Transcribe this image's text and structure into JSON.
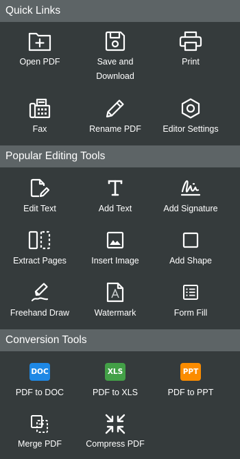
{
  "quick_links": {
    "title": "Quick Links",
    "items": [
      {
        "label": "Open PDF",
        "icon": "folder-plus-icon"
      },
      {
        "label": "Save and\nDownload",
        "icon": "floppy-disk-icon"
      },
      {
        "label": "Print",
        "icon": "printer-icon"
      },
      {
        "label": "Fax",
        "icon": "fax-machine-icon"
      },
      {
        "label": "Rename PDF",
        "icon": "pencil-icon"
      },
      {
        "label": "Editor Settings",
        "icon": "hexagon-gear-icon"
      }
    ]
  },
  "popular_tools": {
    "title": "Popular Editing Tools",
    "items": [
      {
        "label": "Edit Text",
        "icon": "document-pen-icon"
      },
      {
        "label": "Add Text",
        "icon": "text-t-icon"
      },
      {
        "label": "Add Signature",
        "icon": "signature-icon"
      },
      {
        "label": "Extract Pages",
        "icon": "extract-pages-icon"
      },
      {
        "label": "Insert Image",
        "icon": "image-icon"
      },
      {
        "label": "Add Shape",
        "icon": "square-icon"
      },
      {
        "label": "Freehand Draw",
        "icon": "pen-draw-icon"
      },
      {
        "label": "Watermark",
        "icon": "watermark-icon"
      },
      {
        "label": "Form Fill",
        "icon": "form-list-icon"
      }
    ]
  },
  "conversion_tools": {
    "title": "Conversion Tools",
    "items": [
      {
        "label": "PDF to DOC",
        "icon": "doc-badge-icon",
        "badge": "DOC",
        "color": "#1e88e5"
      },
      {
        "label": "PDF to XLS",
        "icon": "xls-badge-icon",
        "badge": "XLS",
        "color": "#43a047"
      },
      {
        "label": "PDF to PPT",
        "icon": "ppt-badge-icon",
        "badge": "PPT",
        "color": "#fb8c00"
      },
      {
        "label": "Merge PDF",
        "icon": "merge-icon"
      },
      {
        "label": "Compress PDF",
        "icon": "compress-arrows-icon"
      }
    ]
  },
  "colors": {
    "panel_bg": "#353b3c",
    "header_bg": "#5d6466",
    "text": "#ffffff"
  }
}
